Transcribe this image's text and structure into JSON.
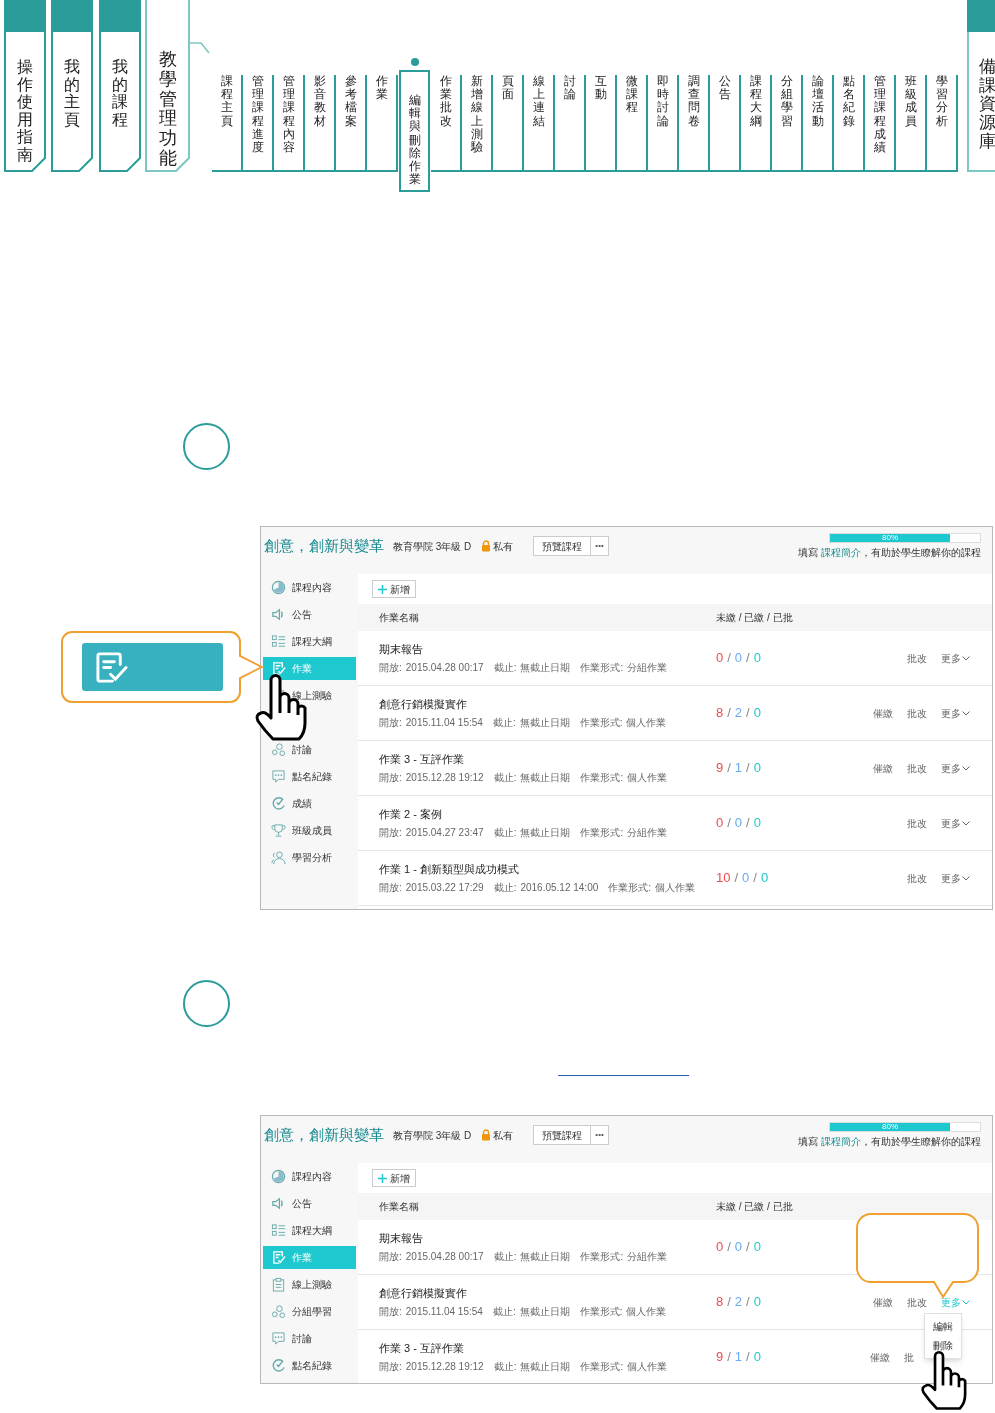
{
  "top_nav": {
    "main_tabs": [
      {
        "label": "操作使用指南",
        "selected": false
      },
      {
        "label": "我的主頁",
        "selected": false
      },
      {
        "label": "我的課程",
        "selected": false
      },
      {
        "label": "教學管理功能",
        "selected": true
      }
    ],
    "sub_items": [
      {
        "label": "課程主頁",
        "selected": false
      },
      {
        "label": "管理課程進度",
        "selected": false
      },
      {
        "label": "管理課程內容",
        "selected": false
      },
      {
        "label": "影音教材",
        "selected": false
      },
      {
        "label": "參考檔案",
        "selected": false
      },
      {
        "label": "作業",
        "selected": false
      },
      {
        "label": "編輯與刪除作業",
        "selected": true
      },
      {
        "label": "作業批改",
        "selected": false
      },
      {
        "label": "新增線上測驗",
        "selected": false
      },
      {
        "label": "頁面",
        "selected": false
      },
      {
        "label": "線上連結",
        "selected": false
      },
      {
        "label": "討論",
        "selected": false
      },
      {
        "label": "互動",
        "selected": false
      },
      {
        "label": "微課程",
        "selected": false
      },
      {
        "label": "即時討論",
        "selected": false
      },
      {
        "label": "調查問卷",
        "selected": false
      },
      {
        "label": "公告",
        "selected": false
      },
      {
        "label": "課程大綱",
        "selected": false
      },
      {
        "label": "分組學習",
        "selected": false
      },
      {
        "label": "論壇活動",
        "selected": false
      },
      {
        "label": "點名紀錄",
        "selected": false
      },
      {
        "label": "管理課程成績",
        "selected": false
      },
      {
        "label": "班級成員",
        "selected": false
      },
      {
        "label": "學習分析",
        "selected": false
      }
    ],
    "side_tab": {
      "label": "備課資源庫"
    }
  },
  "screenshots": [
    {
      "course_title": "創意，創新與變革",
      "course_meta": "教育學院 3年級 D",
      "privacy": "私有",
      "preview_button": "預覽課程",
      "more_button": "•••",
      "progress": {
        "level": 0.8,
        "label": "80%",
        "hint_before": "填寫 ",
        "hint_link": "課程簡介",
        "hint_after": "，有助於學生瞭解你的課程"
      },
      "sidebar": [
        {
          "label": "課程內容",
          "selected": false
        },
        {
          "label": "公告",
          "selected": false
        },
        {
          "label": "課程大綱",
          "selected": false
        },
        {
          "label": "作業",
          "selected": true
        },
        {
          "label": "線上測驗",
          "selected": false
        },
        {
          "label": "討論",
          "selected": false
        },
        {
          "label": "點名紀錄",
          "selected": false
        },
        {
          "label": "成績",
          "selected": false
        },
        {
          "label": "班級成員",
          "selected": false
        },
        {
          "label": "學習分析",
          "selected": false
        }
      ],
      "add_button": "新增",
      "columns": [
        "作業名稱",
        "未繳 / 已繳 / 已批"
      ],
      "count_separator": "/",
      "rows": [
        {
          "title": "期末報告",
          "open_label": "開放:",
          "open": "2015.04.28 00:17",
          "due_label": "截止:",
          "due": "無截止日期",
          "type_label": "作業形式:",
          "type": "分組作業",
          "counts": [
            "0",
            "0",
            "0"
          ],
          "actions": [
            "批改"
          ],
          "more": {
            "label": "更多",
            "active": false
          }
        },
        {
          "title": "創意行銷模擬實作",
          "open_label": "開放:",
          "open": "2015.11.04 15:54",
          "due_label": "截止:",
          "due": "無截止日期",
          "type_label": "作業形式:",
          "type": "個人作業",
          "counts": [
            "8",
            "2",
            "0"
          ],
          "actions": [
            "催繳",
            "批改"
          ],
          "more": {
            "label": "更多",
            "active": false
          }
        },
        {
          "title": "作業 3 - 互評作業",
          "open_label": "開放:",
          "open": "2015.12.28 19:12",
          "due_label": "截止:",
          "due": "無截止日期",
          "type_label": "作業形式:",
          "type": "個人作業",
          "counts": [
            "9",
            "1",
            "0"
          ],
          "actions": [
            "催繳",
            "批改"
          ],
          "more": {
            "label": "更多",
            "active": false
          }
        },
        {
          "title": "作業 2 - 案例",
          "open_label": "開放:",
          "open": "2015.04.27 23:47",
          "due_label": "截止:",
          "due": "無截止日期",
          "type_label": "作業形式:",
          "type": "分組作業",
          "counts": [
            "0",
            "0",
            "0"
          ],
          "actions": [
            "批改"
          ],
          "more": {
            "label": "更多",
            "active": false
          }
        },
        {
          "title": "作業 1 - 創新類型與成功模式",
          "open_label": "開放:",
          "open": "2015.03.22 17:29",
          "due_label": "截止:",
          "due": "2016.05.12 14:00",
          "type_label": "作業形式:",
          "type": "個人作業",
          "counts": [
            "10",
            "0",
            "0"
          ],
          "actions": [
            "批改"
          ],
          "more": {
            "label": "更多",
            "active": false
          }
        }
      ]
    },
    {
      "course_title": "創意，創新與變革",
      "course_meta": "教育學院 3年級 D",
      "privacy": "私有",
      "preview_button": "預覽課程",
      "more_button": "•••",
      "progress": {
        "level": 0.8,
        "label": "80%",
        "hint_before": "填寫 ",
        "hint_link": "課程簡介",
        "hint_after": "，有助於學生瞭解你的課程"
      },
      "sidebar": [
        {
          "label": "課程內容",
          "selected": false
        },
        {
          "label": "公告",
          "selected": false
        },
        {
          "label": "課程大綱",
          "selected": false
        },
        {
          "label": "作業",
          "selected": true
        },
        {
          "label": "線上測驗",
          "selected": false
        },
        {
          "label": "分組學習",
          "selected": false
        },
        {
          "label": "討論",
          "selected": false
        },
        {
          "label": "點名紀錄",
          "selected": false
        }
      ],
      "add_button": "新增",
      "columns": [
        "作業名稱",
        "未繳 / 已繳 / 已批"
      ],
      "count_separator": "/",
      "rows": [
        {
          "title": "期末報告",
          "open_label": "開放:",
          "open": "2015.04.28 00:17",
          "due_label": "截止:",
          "due": "無截止日期",
          "type_label": "作業形式:",
          "type": "分組作業",
          "counts": [
            "0",
            "0",
            "0"
          ],
          "actions": []
        },
        {
          "title": "創意行銷模擬實作",
          "open_label": "開放:",
          "open": "2015.11.04 15:54",
          "due_label": "截止:",
          "due": "無截止日期",
          "type_label": "作業形式:",
          "type": "個人作業",
          "counts": [
            "8",
            "2",
            "0"
          ],
          "actions": [
            "催繳",
            "批改"
          ],
          "more": {
            "label": "更多",
            "active": true
          }
        },
        {
          "title": "作業 3 - 互評作業",
          "open_label": "開放:",
          "open": "2015.12.28 19:12",
          "due_label": "截止:",
          "due": "無截止日期",
          "type_label": "作業形式:",
          "type": "個人作業",
          "counts": [
            "9",
            "1",
            "0"
          ],
          "actions": [
            "催繳",
            "批"
          ]
        }
      ],
      "dropdown": [
        "編輯",
        "刪除"
      ]
    }
  ]
}
